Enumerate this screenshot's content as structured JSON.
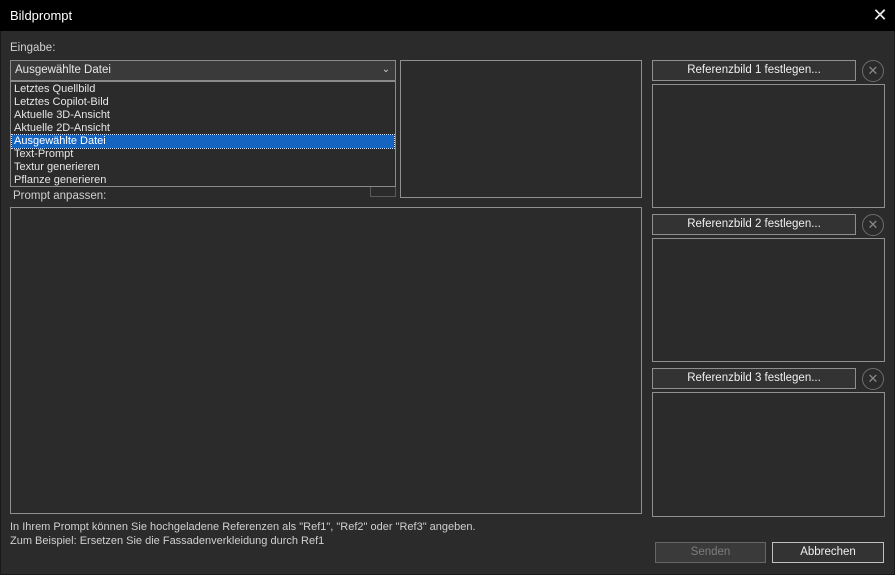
{
  "window": {
    "title": "Bildprompt",
    "close_glyph": "✕"
  },
  "input": {
    "label": "Eingabe:",
    "selected": "Ausgewählte Datei",
    "arrow_glyph": "⌄",
    "options": [
      {
        "label": "Letztes Quellbild",
        "selected": false
      },
      {
        "label": "Letztes Copilot-Bild",
        "selected": false
      },
      {
        "label": "Aktuelle 3D-Ansicht",
        "selected": false
      },
      {
        "label": "Aktuelle 2D-Ansicht",
        "selected": false
      },
      {
        "label": "Ausgewählte Datei",
        "selected": true
      },
      {
        "label": "Text-Prompt",
        "selected": false
      },
      {
        "label": "Textur generieren",
        "selected": false
      },
      {
        "label": "Pflanze generieren",
        "selected": false
      }
    ]
  },
  "prompt": {
    "label": "Prompt anpassen:"
  },
  "references": [
    {
      "button": "Referenzbild 1 festlegen...",
      "clear_glyph": "✕"
    },
    {
      "button": "Referenzbild 2 festlegen...",
      "clear_glyph": "✕"
    },
    {
      "button": "Referenzbild 3 festlegen...",
      "clear_glyph": "✕"
    }
  ],
  "hint": {
    "line1": "In Ihrem Prompt können Sie hochgeladene Referenzen als \"Ref1\", \"Ref2\" oder \"Ref3\" angeben.",
    "line2": "Zum Beispiel: Ersetzen Sie die Fassadenverkleidung durch Ref1"
  },
  "actions": {
    "send": "Senden",
    "cancel": "Abbrechen"
  },
  "colors": {
    "background": "#2b2b2b",
    "titlebar": "#000000",
    "selection": "#1565c0",
    "border": "#8f8f8f"
  }
}
